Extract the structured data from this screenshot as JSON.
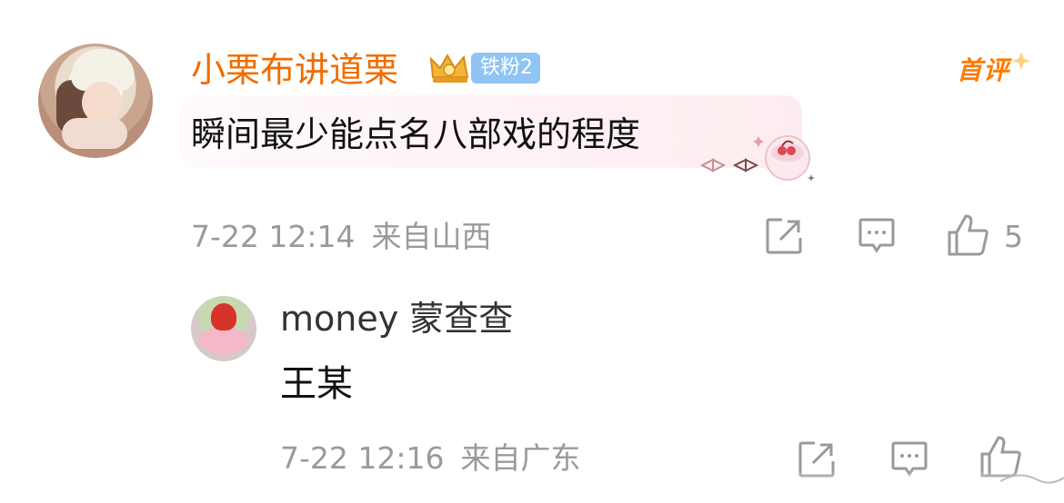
{
  "main_comment": {
    "username": "小栗布讲道栗",
    "fan_badge": "铁粉2",
    "first_comment_tag": "首评",
    "text": "瞬间最少能点名八部戏的程度",
    "date": "7-22 12:14",
    "location": "来自山西",
    "like_count": "5",
    "icons": [
      "avatar",
      "crown-icon",
      "share-icon",
      "comment-icon",
      "thumbs-up-icon",
      "bubble-decoration"
    ]
  },
  "reply": {
    "username": "money 蒙查查",
    "text": "王某",
    "date": "7-22 12:16",
    "location": "来自广东",
    "icons": [
      "avatar",
      "share-icon",
      "comment-icon",
      "thumbs-up-icon"
    ]
  },
  "colors": {
    "username_main": "#f06c00",
    "first_comment": "#ff7a00",
    "fan_badge_bg": "#8fc4f4",
    "meta_text": "#9a9a9a",
    "bubble_bg": "#fdecef"
  }
}
